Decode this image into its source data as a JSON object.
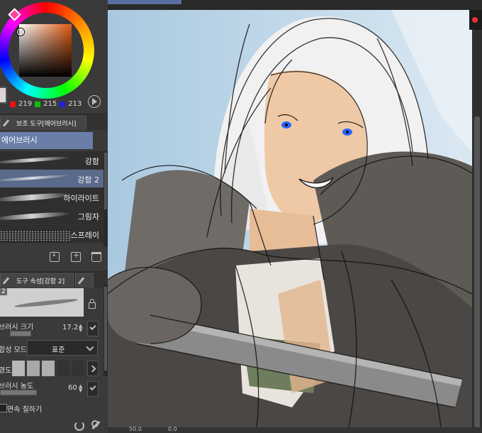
{
  "color": {
    "r": "219",
    "g": "215",
    "b": "213",
    "hue_color": "#e05a10",
    "current_color": "#dcd6d5"
  },
  "subtool": {
    "tab_label": "보조 도구[에어브러시]",
    "group_label": "에어브러시",
    "items": [
      {
        "label": "강함"
      },
      {
        "label": "강함 2"
      },
      {
        "label": "하이라이트"
      },
      {
        "label": "그림자"
      },
      {
        "label": "스프레이"
      }
    ]
  },
  "tool_property": {
    "tab_label": "도구 속성[강함 2]",
    "preview_num": "2",
    "brush_size_label": "브러시 크기",
    "brush_size_value": "17.2",
    "blend_mode_label": "합성 모드",
    "blend_mode_value": "표준",
    "hardness_label": "경도",
    "density_label": "브러시 농도",
    "density_value": "60",
    "continuous_label": "연속 칠하기"
  },
  "status": {
    "zoom": "50.0",
    "angle": "0.0"
  },
  "colors": {
    "accent": "#6a7ea8",
    "selected_item": "#5a6a8a",
    "record": "#ee3333"
  }
}
